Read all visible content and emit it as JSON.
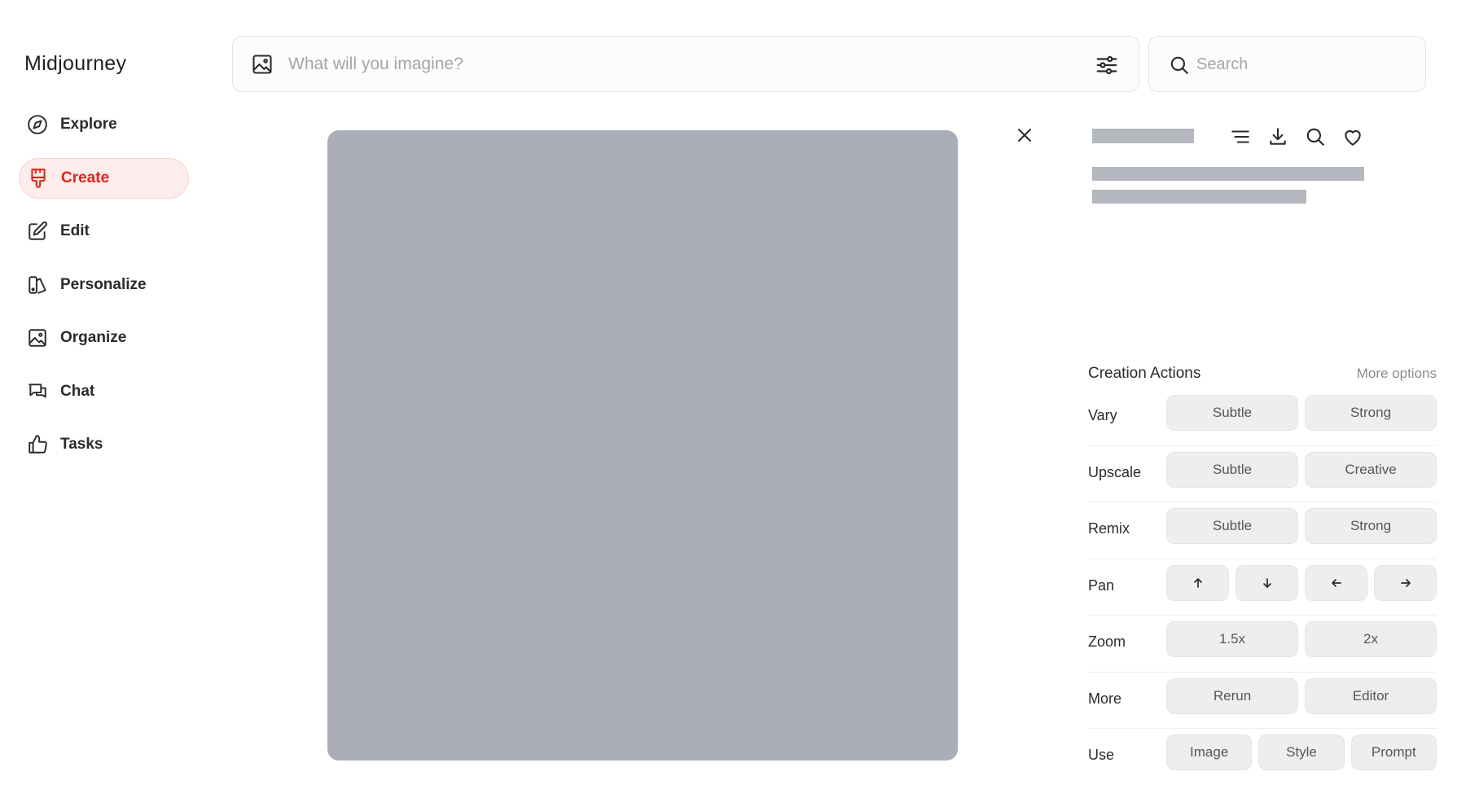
{
  "app": {
    "title": "Midjourney"
  },
  "sidebar": {
    "items": [
      {
        "label": "Explore",
        "icon": "compass-icon",
        "active": false
      },
      {
        "label": "Create",
        "icon": "paintbrush-icon",
        "active": true
      },
      {
        "label": "Edit",
        "icon": "edit-icon",
        "active": false
      },
      {
        "label": "Personalize",
        "icon": "personalize-icon",
        "active": false
      },
      {
        "label": "Organize",
        "icon": "image-icon",
        "active": false
      },
      {
        "label": "Chat",
        "icon": "chat-icon",
        "active": false
      },
      {
        "label": "Tasks",
        "icon": "thumbs-up-icon",
        "active": false
      }
    ]
  },
  "prompt": {
    "placeholder": "What will you imagine?",
    "value": ""
  },
  "search": {
    "placeholder": "Search",
    "value": ""
  },
  "colors": {
    "accent": "#e2231a",
    "accent_bg": "#fdecec",
    "placeholder_image": "#abaeb8"
  },
  "actions": {
    "title": "Creation Actions",
    "more_options": "More options",
    "rows": [
      {
        "label": "Vary",
        "buttons": [
          "Subtle",
          "Strong"
        ]
      },
      {
        "label": "Upscale",
        "buttons": [
          "Subtle",
          "Creative"
        ]
      },
      {
        "label": "Remix",
        "buttons": [
          "Subtle",
          "Strong"
        ]
      },
      {
        "label": "Pan",
        "buttons": [
          "arrow-up-icon",
          "arrow-down-icon",
          "arrow-left-icon",
          "arrow-right-icon"
        ]
      },
      {
        "label": "Zoom",
        "buttons": [
          "1.5x",
          "2x"
        ]
      },
      {
        "label": "More",
        "buttons": [
          "Rerun",
          "Editor"
        ]
      },
      {
        "label": "Use",
        "buttons": [
          "Image",
          "Style",
          "Prompt"
        ]
      }
    ]
  }
}
